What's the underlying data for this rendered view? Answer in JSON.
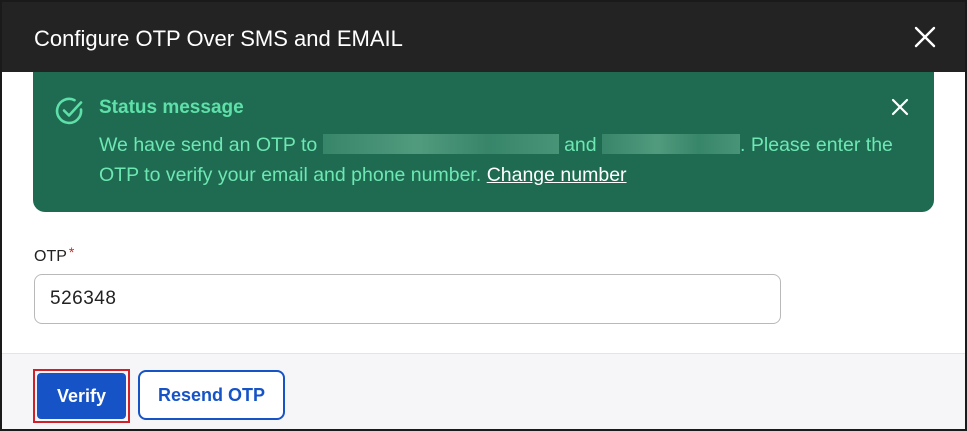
{
  "dialog": {
    "title": "Configure OTP Over SMS and EMAIL"
  },
  "status": {
    "heading": "Status message",
    "msg_part1": "We have send an OTP to ",
    "msg_part2": " and ",
    "msg_part3": ". Please enter the OTP to verify your email and phone number. ",
    "change_link": "Change number"
  },
  "form": {
    "otp_label": "OTP",
    "required_mark": "*",
    "otp_value": "526348"
  },
  "footer": {
    "verify_label": "Verify",
    "resend_label": "Resend OTP"
  },
  "colors": {
    "titlebar_bg": "#232323",
    "status_bg": "#1e6b52",
    "status_text": "#6ee7b3",
    "primary": "#1553c7",
    "highlight_border": "#d0202a"
  }
}
